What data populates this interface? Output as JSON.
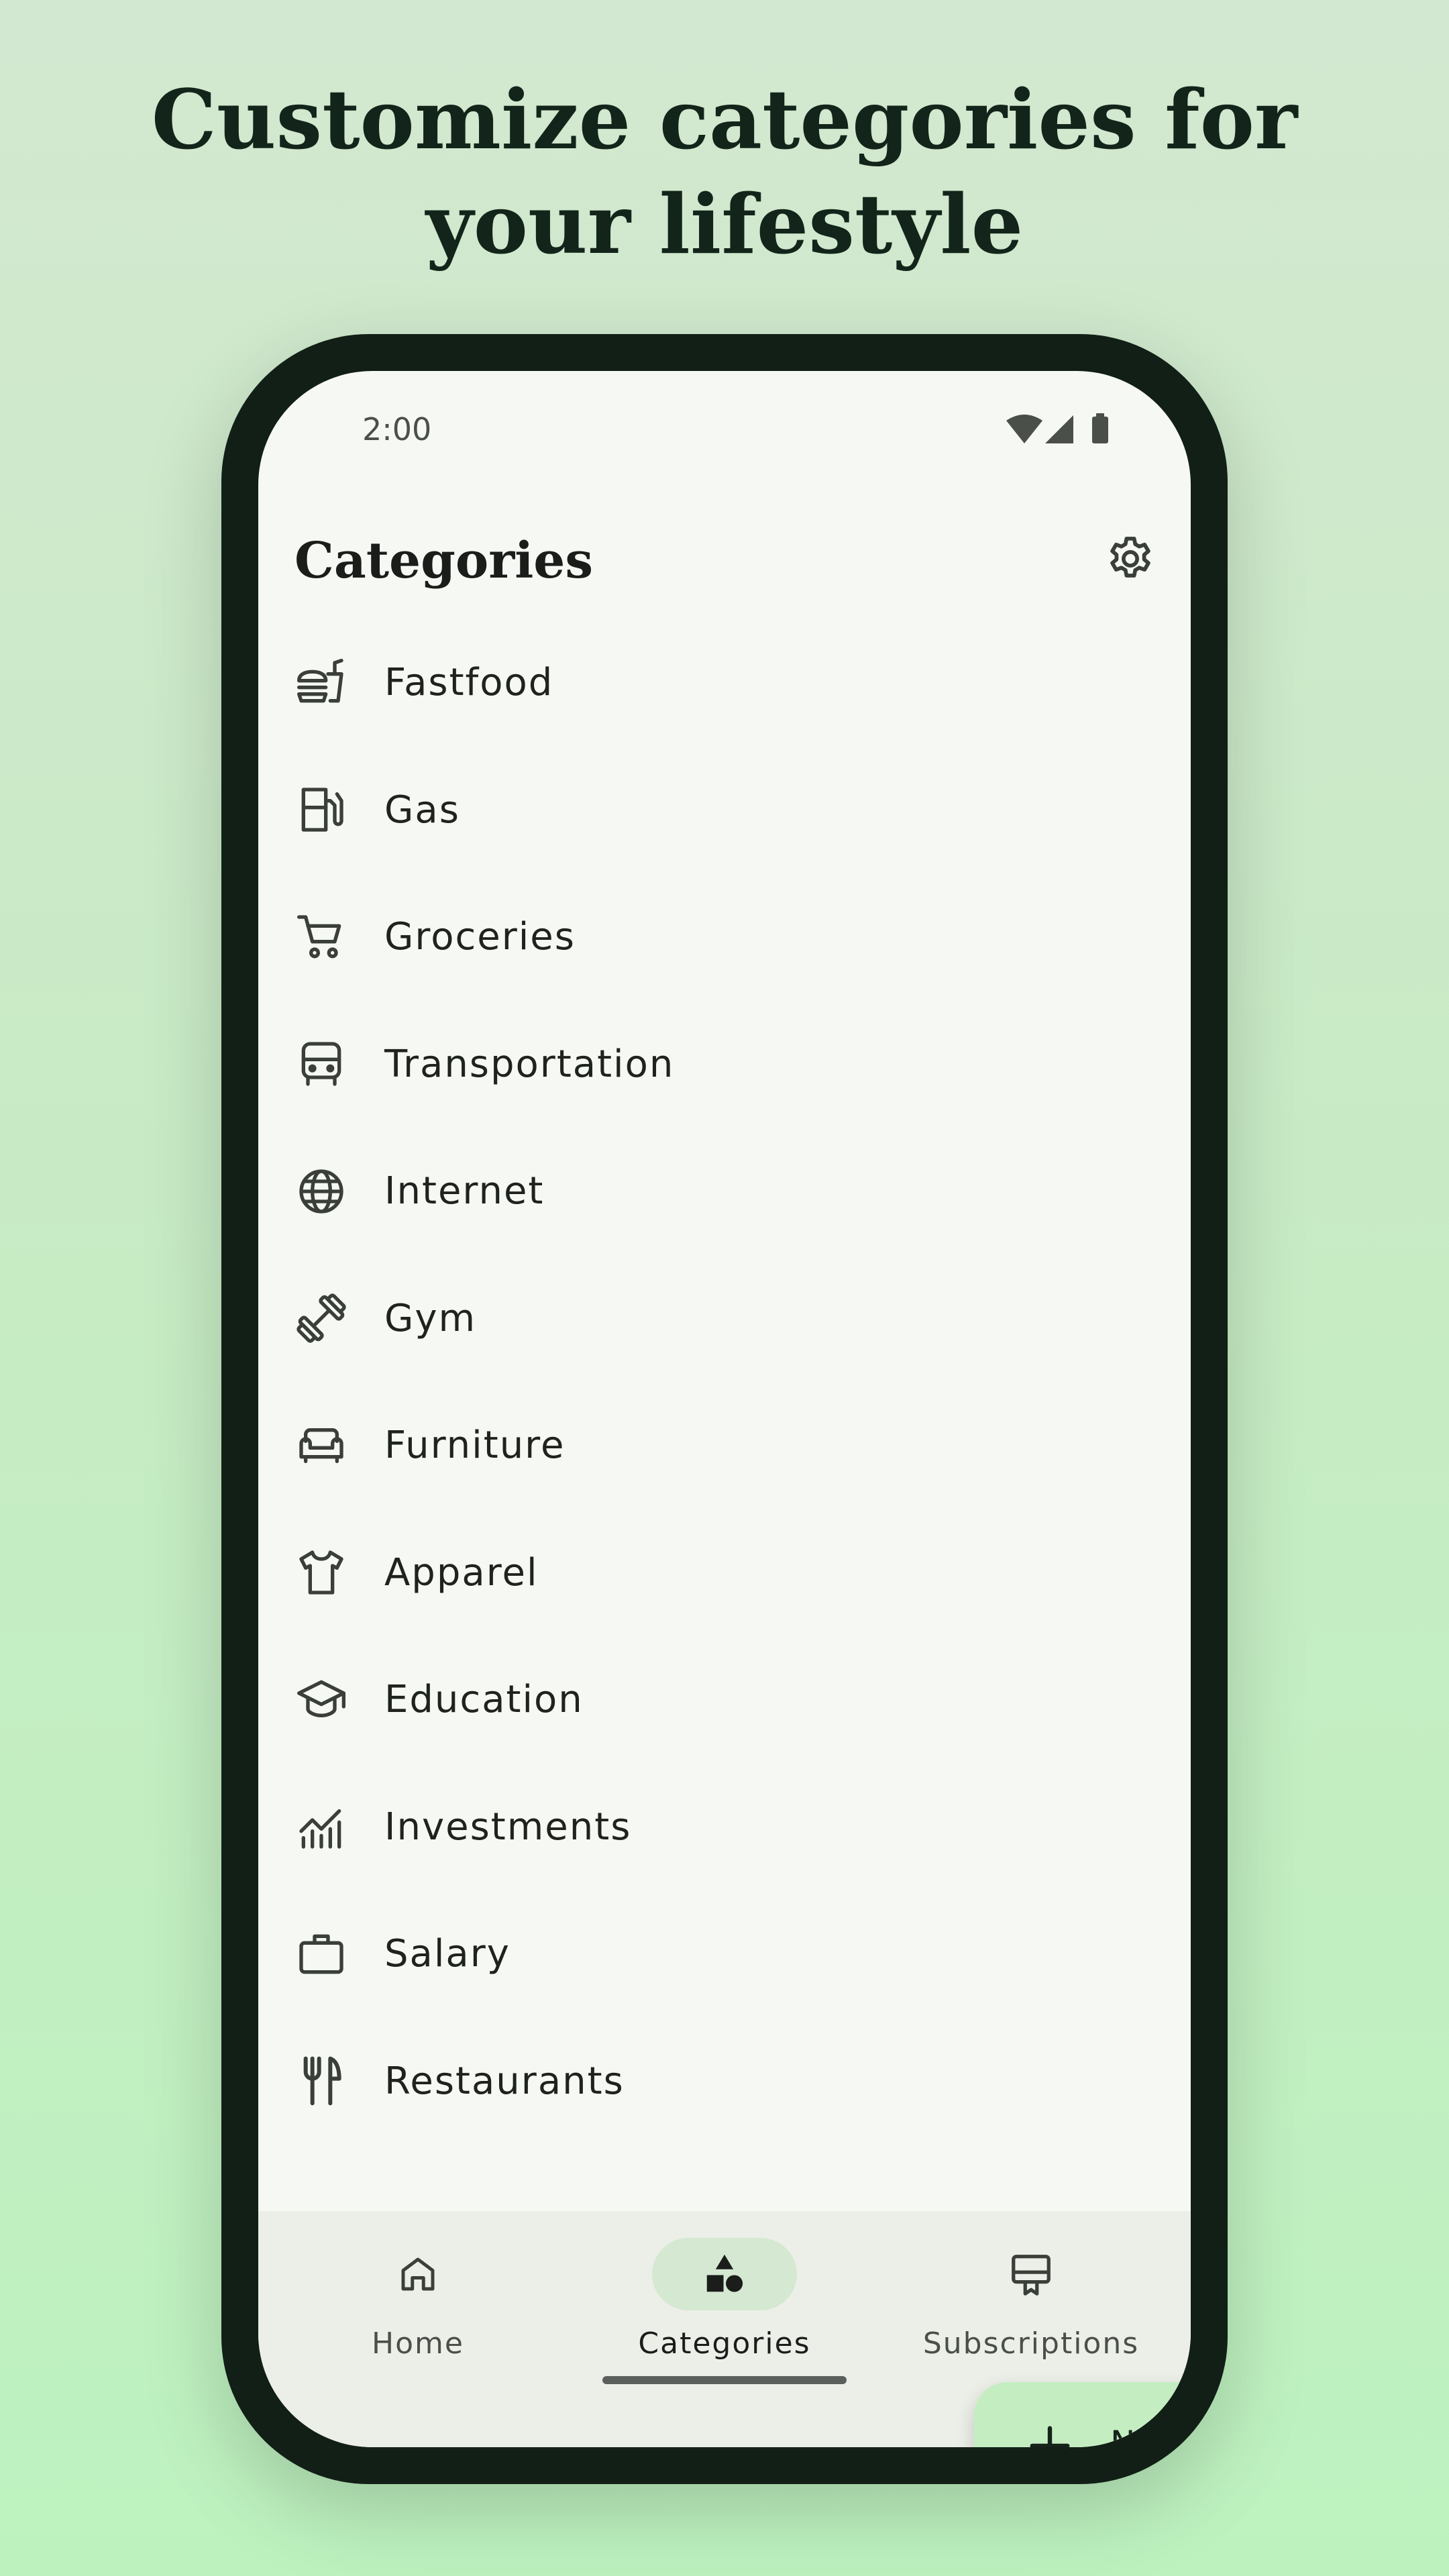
{
  "headline": {
    "line1": "Customize categories for",
    "line2": "your lifestyle"
  },
  "status_bar": {
    "time": "2:00",
    "icons": [
      "wifi-icon",
      "signal-icon",
      "battery-icon"
    ]
  },
  "app_bar": {
    "title": "Categories",
    "action_icon": "settings-icon"
  },
  "categories": [
    {
      "label": "Fastfood",
      "icon": "fastfood-icon"
    },
    {
      "label": "Gas",
      "icon": "gas-station-icon"
    },
    {
      "label": "Groceries",
      "icon": "shopping-cart-icon"
    },
    {
      "label": "Transportation",
      "icon": "bus-icon"
    },
    {
      "label": "Internet",
      "icon": "globe-icon"
    },
    {
      "label": "Gym",
      "icon": "dumbbell-icon"
    },
    {
      "label": "Furniture",
      "icon": "armchair-icon"
    },
    {
      "label": "Apparel",
      "icon": "tshirt-icon"
    },
    {
      "label": "Education",
      "icon": "graduation-cap-icon"
    },
    {
      "label": "Investments",
      "icon": "chart-icon"
    },
    {
      "label": "Salary",
      "icon": "briefcase-icon"
    },
    {
      "label": "Restaurants",
      "icon": "fork-knife-icon"
    }
  ],
  "fab": {
    "label": "New category",
    "icon": "plus-icon"
  },
  "bottom_nav": {
    "items": [
      {
        "label": "Home",
        "icon": "home-icon",
        "active": false
      },
      {
        "label": "Categories",
        "icon": "shapes-icon",
        "active": true
      },
      {
        "label": "Subscriptions",
        "icon": "subscriptions-icon",
        "active": false
      }
    ]
  },
  "colors": {
    "background_top": "#d3e8d0",
    "background_bottom": "#bdf2bf",
    "phone_frame": "#111f16",
    "screen": "#f6f9f3",
    "fab": "#c4eec2",
    "nav_bar": "#ecefe8",
    "active_pill": "#d4e8d2"
  }
}
